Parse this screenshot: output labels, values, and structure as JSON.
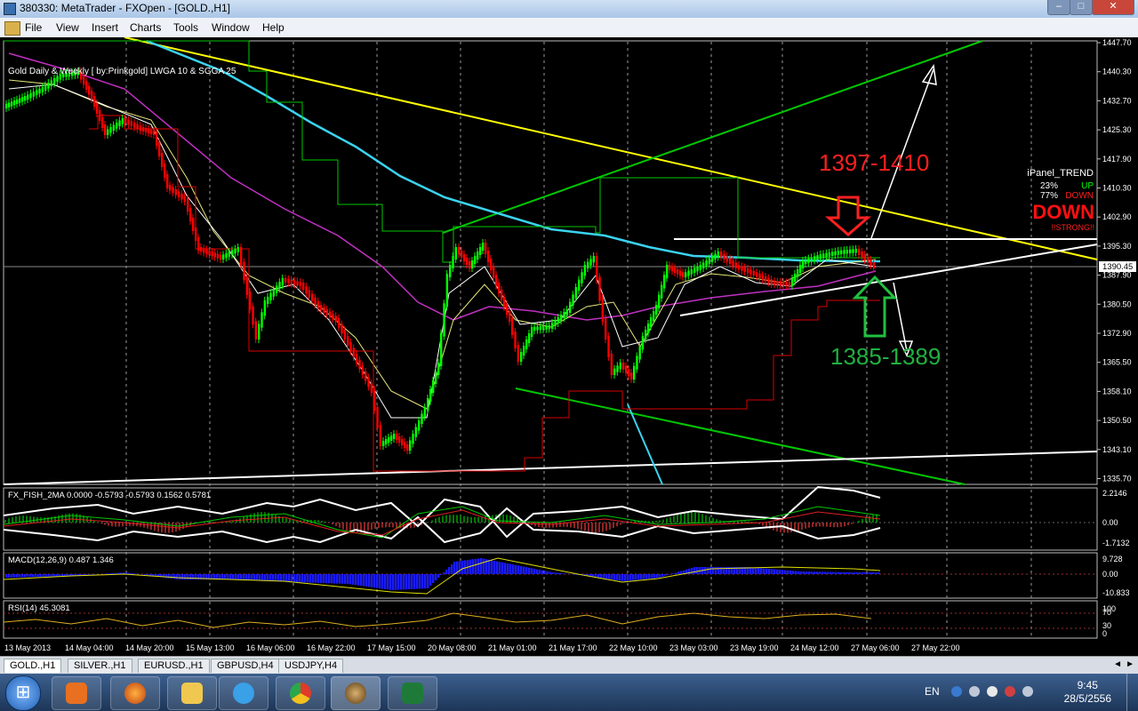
{
  "window": {
    "title": "380330: MetaTrader - FXOpen - [GOLD.,H1]",
    "minimize": "–",
    "maximize": "□",
    "close": "✕"
  },
  "menu": {
    "items": [
      "File",
      "View",
      "Insert",
      "Charts",
      "Tools",
      "Window",
      "Help"
    ],
    "mdi_min": "–",
    "mdi_restore": "❐",
    "mdi_close": "✕"
  },
  "chart": {
    "indicator_label": "Gold Daily & Weekly [ by:Prinkgold]  LWGA 10  &  SGGA 25",
    "current_price": "1390.45",
    "price_ticks": [
      "1447.70",
      "1440.30",
      "1432.70",
      "1425.30",
      "1417.90",
      "1410.30",
      "1402.90",
      "1395.30",
      "1387.90",
      "1380.50",
      "1372.90",
      "1365.50",
      "1358.10",
      "1350.50",
      "1343.10",
      "1335.70"
    ],
    "time_ticks": [
      "13 May 2013",
      "14 May 04:00",
      "14 May 20:00",
      "15 May 13:00",
      "16 May 06:00",
      "16 May 22:00",
      "17 May 15:00",
      "20 May 08:00",
      "21 May 01:00",
      "21 May 17:00",
      "22 May 10:00",
      "23 May 03:00",
      "23 May 19:00",
      "24 May 12:00",
      "27 May 06:00",
      "27 May 22:00"
    ],
    "annotation_resistance": "1397-1410",
    "annotation_support": "1385-1389",
    "ipanel": {
      "title": "iPanel_TREND",
      "up_pct": "23%",
      "up_label": "UP",
      "down_pct": "77%",
      "down_label": "DOWN",
      "big": "DOWN",
      "strong": "!!STRONG!!"
    },
    "colors": {
      "bull": "#00ff00",
      "bear": "#ff0000",
      "yellow_line": "#ffff00",
      "green_line": "#00c800",
      "cyan_ma": "#3ad3f0",
      "magenta_ma": "#c030c0",
      "white_line": "#ffffff"
    }
  },
  "fisher": {
    "label": "FX_FISH_2MA 0.0000 -0.5793 -0.5793 0.1562 0.5781",
    "ticks": [
      "2.2146",
      "0.00",
      "-1.7132"
    ]
  },
  "macd": {
    "label": "MACD(12,26,9) 0.487 1.346",
    "ticks": [
      "9.728",
      "0.00",
      "-10.833"
    ]
  },
  "rsi": {
    "label": "RSI(14) 45.3081",
    "ticks": [
      "100",
      "70",
      "30",
      "0"
    ]
  },
  "tabs": [
    "GOLD.,H1",
    "SILVER.,H1",
    "EURUSD.,H1",
    "GBPUSD,H4",
    "USDJPY,H4"
  ],
  "taskbar": {
    "start": "⊞",
    "lang": "EN",
    "time": "9:45",
    "date": "28/5/2556"
  }
}
